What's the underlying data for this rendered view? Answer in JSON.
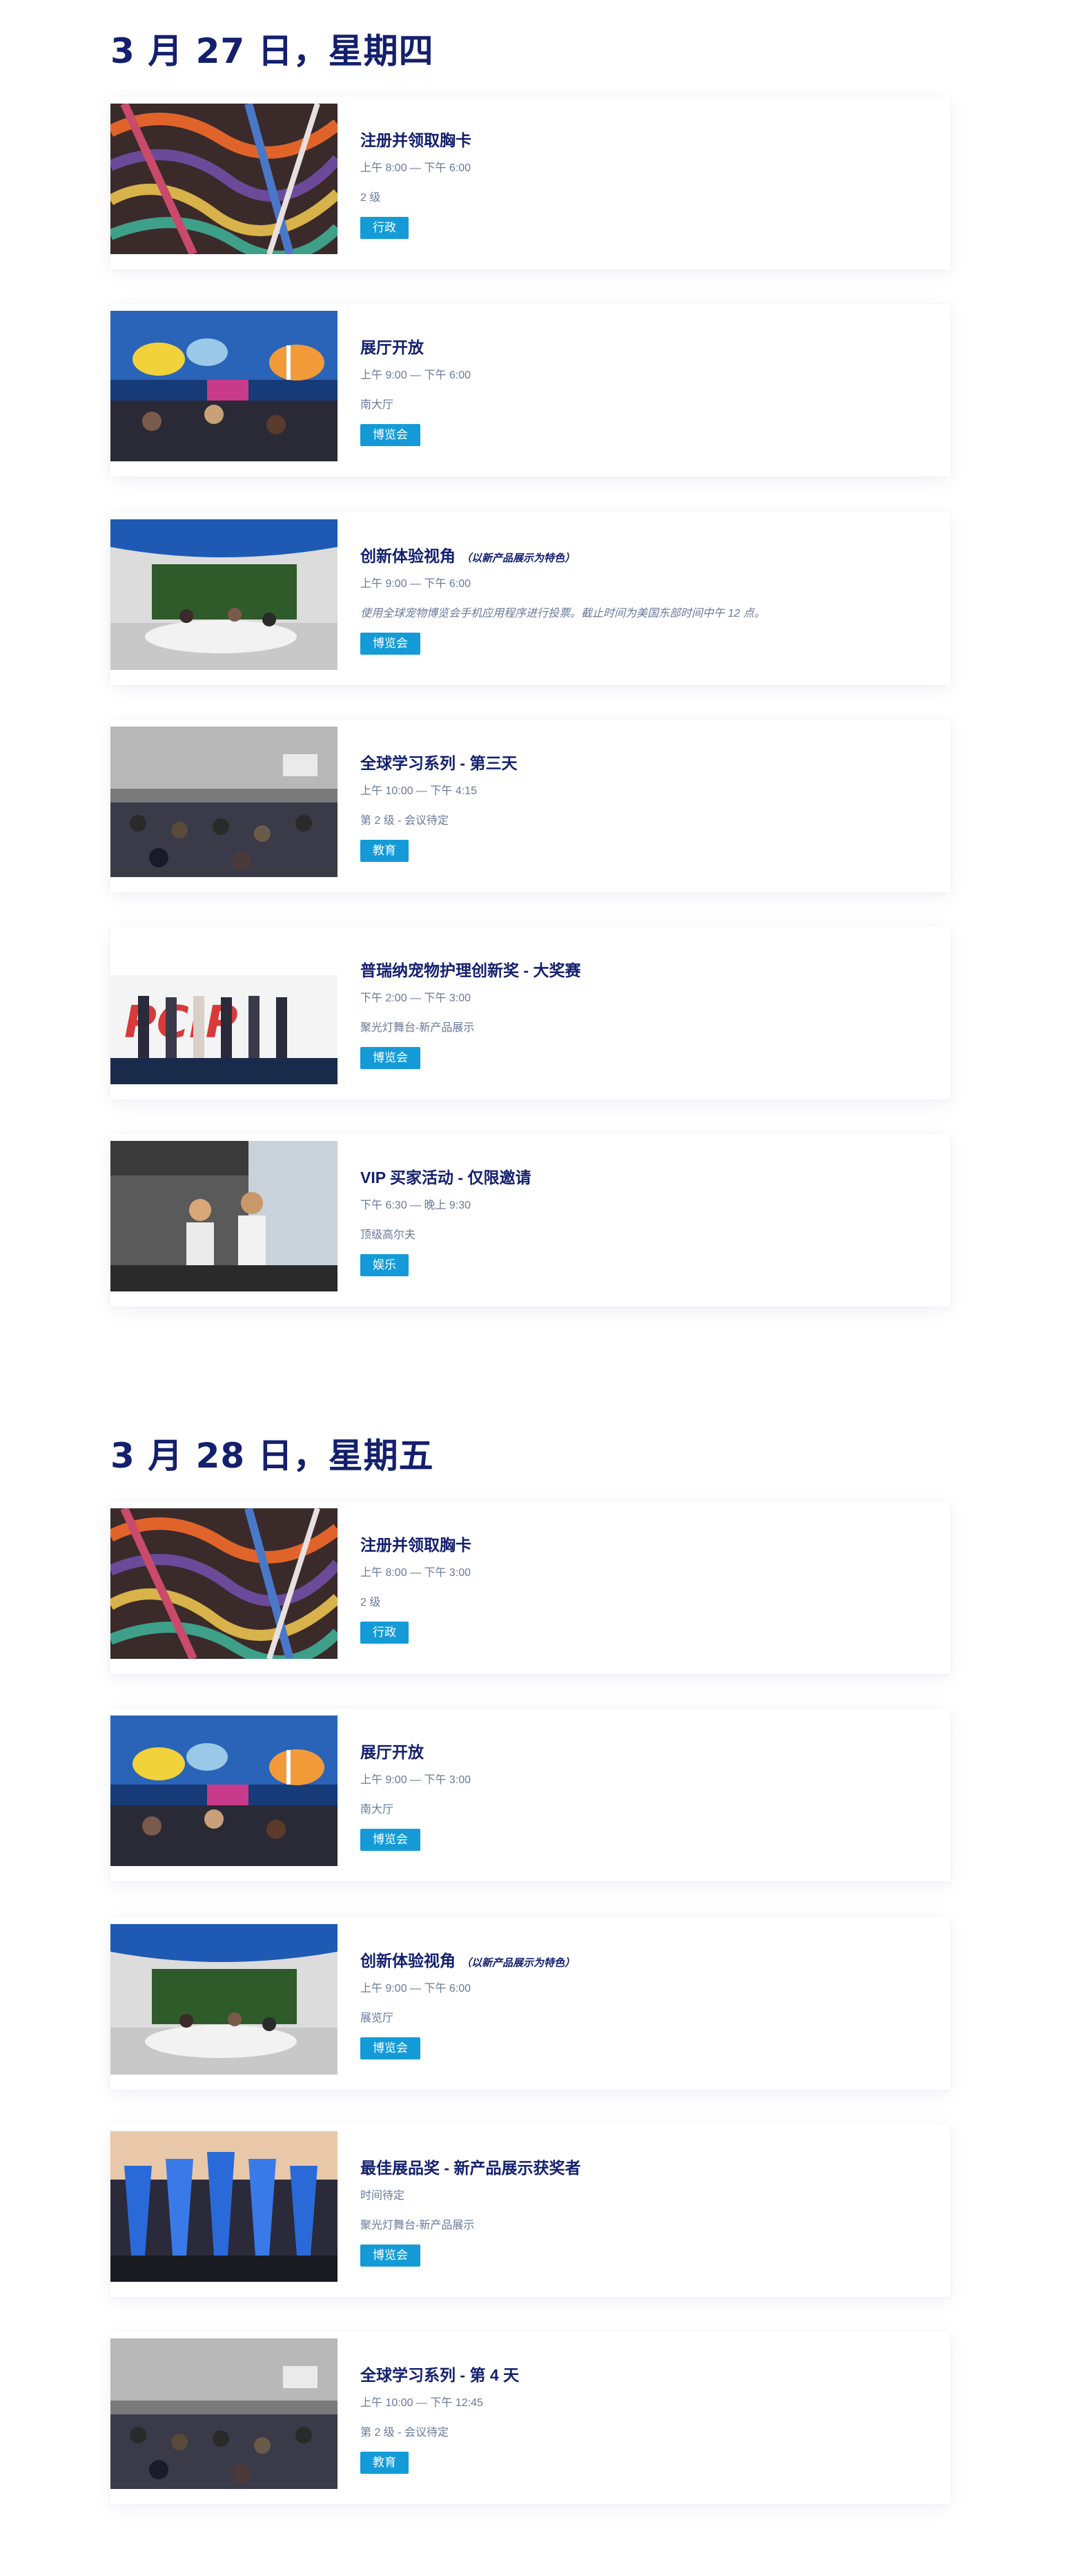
{
  "days": [
    {
      "heading": "3 月 27 日，星期四",
      "events": [
        {
          "title": "注册并领取胸卡",
          "subtitle": "",
          "time": "上午 8:00 — 下午 6:00",
          "location": "2 级",
          "tag": "行政",
          "image": "badge-lanyards-photo"
        },
        {
          "title": "展厅开放",
          "subtitle": "",
          "time": "上午 9:00 — 下午 6:00",
          "location": "南大厅",
          "tag": "博览会",
          "image": "expo-hall-fish-photo"
        },
        {
          "title": "创新体验视角",
          "subtitle": "（以新产品展示为特色）",
          "time": "上午 9:00 — 下午 6:00",
          "location": "使用全球宠物博览会手机应用程序进行投票。截止时间为美国东部时间中午 12 点。",
          "tag": "博览会",
          "image": "new-products-showcase-photo"
        },
        {
          "title": "全球学习系列 - 第三天",
          "subtitle": "",
          "time": "上午 10:00 — 下午 4:15",
          "location": "第 2 级 - 会议待定",
          "tag": "教育",
          "image": "conference-audience-photo"
        },
        {
          "title": "普瑞纳宠物护理创新奖 - 大奖赛",
          "subtitle": "",
          "time": "下午 2:00 — 下午 3:00",
          "location": "聚光灯舞台-新产品展示",
          "tag": "博览会",
          "image": "pcip-stage-photo"
        },
        {
          "title": "VIP 买家活动 - 仅限邀请",
          "subtitle": "",
          "time": "下午 6:30 — 晚上 9:30",
          "location": "顶级高尔夫",
          "tag": "娱乐",
          "image": "golf-venue-photo"
        }
      ]
    },
    {
      "heading": "3 月 28 日，星期五",
      "events": [
        {
          "title": "注册并领取胸卡",
          "subtitle": "",
          "time": "上午 8:00 — 下午 3:00",
          "location": "2 级",
          "tag": "行政",
          "image": "badge-lanyards-photo"
        },
        {
          "title": "展厅开放",
          "subtitle": "",
          "time": "上午 9:00 — 下午 3:00",
          "location": "南大厅",
          "tag": "博览会",
          "image": "expo-hall-fish-photo"
        },
        {
          "title": "创新体验视角",
          "subtitle": "（以新产品展示为特色）",
          "time": "上午 9:00 — 下午 6:00",
          "location": "展览厅",
          "tag": "博览会",
          "image": "new-products-showcase-photo"
        },
        {
          "title": "最佳展品奖 - 新产品展示获奖者",
          "subtitle": "",
          "time": "时间待定",
          "location": "聚光灯舞台-新产品展示",
          "tag": "博览会",
          "image": "award-trophies-photo"
        },
        {
          "title": "全球学习系列 - 第 4 天",
          "subtitle": "",
          "time": "上午 10:00 — 下午 12:45",
          "location": "第 2 级 - 会议待定",
          "tag": "教育",
          "image": "conference-audience-photo"
        }
      ]
    }
  ],
  "colors": {
    "heading": "#14206e",
    "muted": "#6a7898",
    "tag": "#149bd7"
  }
}
